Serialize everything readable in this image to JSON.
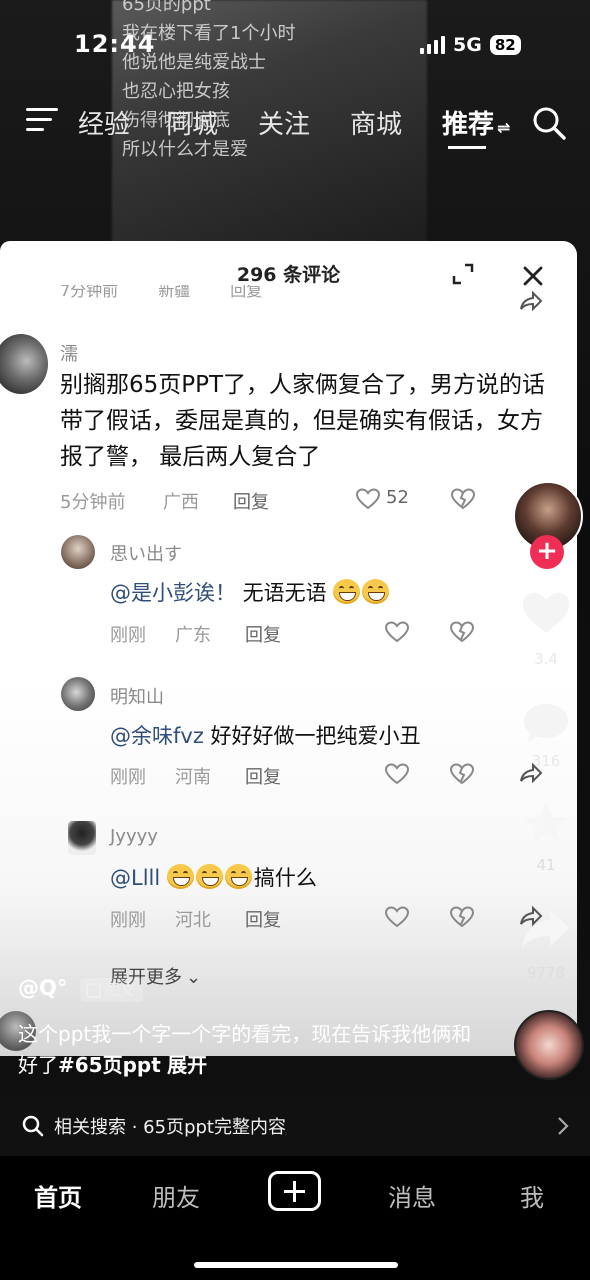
{
  "status_bar": {
    "time": "12:44",
    "network": "5G",
    "battery": "82"
  },
  "video_overlay_text": [
    "65页的ppt",
    "我在楼下看了1个小时",
    "他说他是纯爱战士",
    "也忍心把女孩",
    "伤得彻彻底底",
    "所以什么才是爱"
  ],
  "top_nav": {
    "tabs": [
      "经验",
      "同城",
      "关注",
      "商城",
      "推荐"
    ],
    "active": "推荐"
  },
  "comments_panel": {
    "title": "296 条评论",
    "cut_row": {
      "time": "7分钟前",
      "location": "新疆",
      "reply": "回复"
    },
    "main_comment": {
      "name": "濡",
      "text": "别搁那65页PPT了，人家俩复合了，男方说的话带了假话，委屈是真的，但是确实有假话，女方报了警， 最后两人复合了",
      "time": "5分钟前",
      "location": "广西",
      "reply": "回复",
      "likes": "52"
    },
    "replies": [
      {
        "name": "思い出す",
        "mention": "@是小彭诶！",
        "text": " 无语无语",
        "emoji_count": 2,
        "time": "刚刚",
        "location": "广东",
        "reply": "回复"
      },
      {
        "name": "明知山",
        "mention": "@余味fvz",
        "text": " 好好好做一把纯爱小丑",
        "emoji_count": 0,
        "time": "刚刚",
        "location": "河南",
        "reply": "回复"
      },
      {
        "name": "Jyyyy",
        "mention": "@Llll",
        "text": "搞什么",
        "emoji_count": 3,
        "time": "刚刚",
        "location": "河北",
        "reply": "回复"
      }
    ],
    "expand_more": "展开更多"
  },
  "rail": {
    "like_count": "3.4",
    "comment_count": "316",
    "favorite_count": "41",
    "share_count": "9778"
  },
  "post": {
    "author": "@Q°",
    "tag": "图文",
    "caption": "这个ppt我一个字一个字的看完，现在告诉我他俩和好了",
    "hashtag": "#65页ppt",
    "expand": "展开"
  },
  "related_search": {
    "label": "相关搜索 · 65页ppt完整内容"
  },
  "bottom_tabs": {
    "home": "首页",
    "friends": "朋友",
    "messages": "消息",
    "me": "我"
  },
  "colors": {
    "like_red": "#f02d55",
    "mention_blue": "#2f4e7a",
    "panel_bg": "#ffffff"
  }
}
